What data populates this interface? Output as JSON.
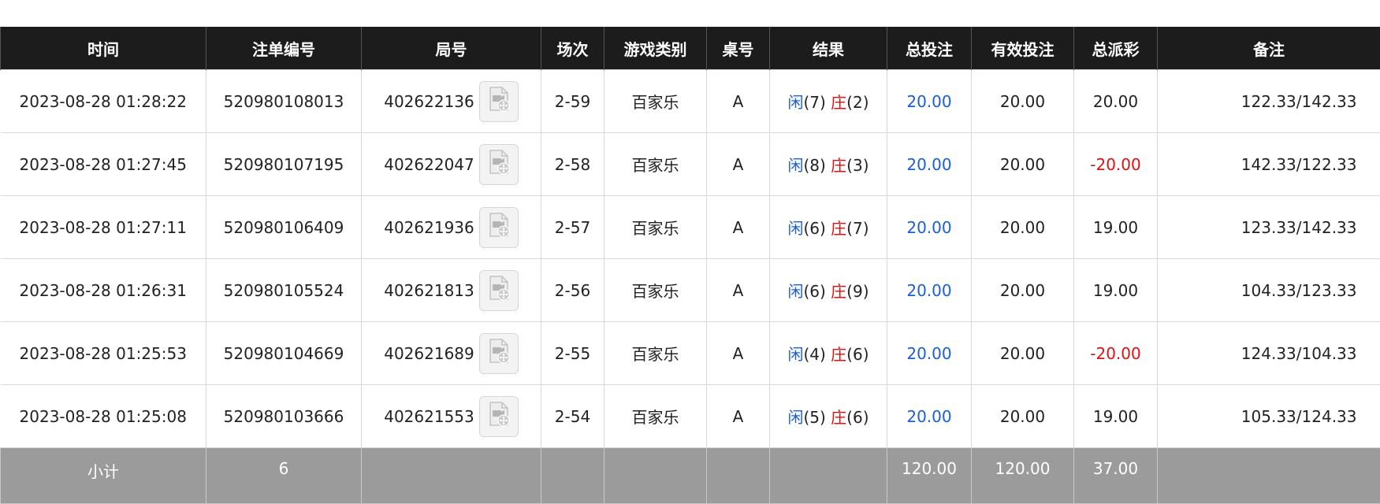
{
  "headers": [
    "时间",
    "注单编号",
    "局号",
    "场次",
    "游戏类别",
    "桌号",
    "结果",
    "总投注",
    "有效投注",
    "总派彩",
    "备注"
  ],
  "rows": [
    {
      "time": "2023-08-28 01:28:22",
      "bet_id": "520980108013",
      "round": "402622136",
      "shoe": "2-59",
      "game": "百家乐",
      "table": "A",
      "player_label": "闲",
      "player_score": "(7)",
      "banker_label": "庄",
      "banker_score": "(2)",
      "total_bet": "20.00",
      "valid_bet": "20.00",
      "payout": "20.00",
      "payout_negative": false,
      "note": "122.33/142.33"
    },
    {
      "time": "2023-08-28 01:27:45",
      "bet_id": "520980107195",
      "round": "402622047",
      "shoe": "2-58",
      "game": "百家乐",
      "table": "A",
      "player_label": "闲",
      "player_score": "(8)",
      "banker_label": "庄",
      "banker_score": "(3)",
      "total_bet": "20.00",
      "valid_bet": "20.00",
      "payout": "-20.00",
      "payout_negative": true,
      "note": "142.33/122.33"
    },
    {
      "time": "2023-08-28 01:27:11",
      "bet_id": "520980106409",
      "round": "402621936",
      "shoe": "2-57",
      "game": "百家乐",
      "table": "A",
      "player_label": "闲",
      "player_score": "(6)",
      "banker_label": "庄",
      "banker_score": "(7)",
      "total_bet": "20.00",
      "valid_bet": "20.00",
      "payout": "19.00",
      "payout_negative": false,
      "note": "123.33/142.33"
    },
    {
      "time": "2023-08-28 01:26:31",
      "bet_id": "520980105524",
      "round": "402621813",
      "shoe": "2-56",
      "game": "百家乐",
      "table": "A",
      "player_label": "闲",
      "player_score": "(6)",
      "banker_label": "庄",
      "banker_score": "(9)",
      "total_bet": "20.00",
      "valid_bet": "20.00",
      "payout": "19.00",
      "payout_negative": false,
      "note": "104.33/123.33"
    },
    {
      "time": "2023-08-28 01:25:53",
      "bet_id": "520980104669",
      "round": "402621689",
      "shoe": "2-55",
      "game": "百家乐",
      "table": "A",
      "player_label": "闲",
      "player_score": "(4)",
      "banker_label": "庄",
      "banker_score": "(6)",
      "total_bet": "20.00",
      "valid_bet": "20.00",
      "payout": "-20.00",
      "payout_negative": true,
      "note": "124.33/104.33"
    },
    {
      "time": "2023-08-28 01:25:08",
      "bet_id": "520980103666",
      "round": "402621553",
      "shoe": "2-54",
      "game": "百家乐",
      "table": "A",
      "player_label": "闲",
      "player_score": "(5)",
      "banker_label": "庄",
      "banker_score": "(6)",
      "total_bet": "20.00",
      "valid_bet": "20.00",
      "payout": "19.00",
      "payout_negative": false,
      "note": "105.33/124.33"
    }
  ],
  "subtotal": {
    "label": "小计",
    "count": "6",
    "total_bet": "120.00",
    "valid_bet": "120.00",
    "payout": "37.00"
  },
  "icons": {
    "replay": "video-replay-icon"
  },
  "colors": {
    "header_bg": "#1c1c1c",
    "player": "#1a5fd6",
    "banker": "#e01010",
    "negative": "#e01010",
    "subtotal_bg": "#9b9b9b"
  }
}
